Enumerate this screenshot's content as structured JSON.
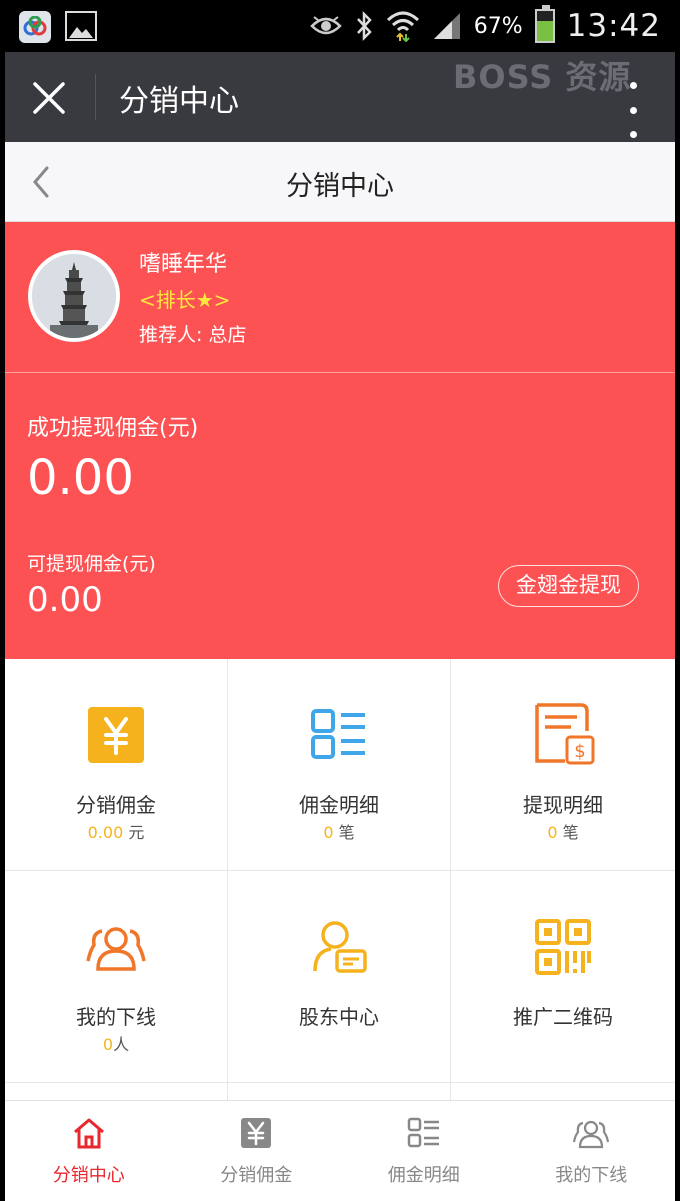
{
  "status_bar": {
    "battery_percent": "67%",
    "battery_level": 0.67,
    "time": "13:42",
    "icons": [
      "app-icon",
      "image-icon",
      "eye-icon",
      "bluetooth-icon",
      "wifi-icon",
      "signal-icon",
      "battery-icon"
    ]
  },
  "title_bar": {
    "title": "分销中心",
    "watermark": "BOSS 资源"
  },
  "page_header": {
    "title": "分销中心"
  },
  "profile": {
    "name": "嗜睡年华",
    "rank": "<排长★>",
    "referrer": "推荐人: 总店"
  },
  "earnings": {
    "success_label": "成功提现佣金(元)",
    "success_value": "0.00",
    "available_label": "可提现佣金(元)",
    "available_value": "0.00",
    "withdraw_button": "金翅金提现"
  },
  "grid": [
    {
      "label": "分销佣金",
      "value": "0.00",
      "unit": "元",
      "icon": "yen-icon",
      "color": "#f6b21d"
    },
    {
      "label": "佣金明细",
      "value": "0",
      "unit": "笔",
      "icon": "list-icon",
      "color": "#3fa6e9"
    },
    {
      "label": "提现明细",
      "value": "0",
      "unit": "笔",
      "icon": "withdraw-record-icon",
      "color": "#f07629"
    },
    {
      "label": "我的下线",
      "value": "0",
      "unit": "人",
      "icon": "users-icon",
      "color": "#f07629"
    },
    {
      "label": "股东中心",
      "value": "",
      "unit": "",
      "icon": "shareholder-icon",
      "color": "#f6b21d"
    },
    {
      "label": "推广二维码",
      "value": "",
      "unit": "",
      "icon": "qrcode-icon",
      "color": "#f6b21d"
    }
  ],
  "bottom_nav": [
    {
      "label": "分销中心",
      "icon": "home-icon",
      "active": true
    },
    {
      "label": "分销佣金",
      "icon": "yen-icon",
      "active": false
    },
    {
      "label": "佣金明细",
      "icon": "list-icon",
      "active": false
    },
    {
      "label": "我的下线",
      "icon": "users-icon",
      "active": false
    }
  ],
  "colors": {
    "hero": "#fc5254",
    "rank": "#ffea3b",
    "active_nav": "#e8272e",
    "value_accent": "#f3b51c"
  }
}
